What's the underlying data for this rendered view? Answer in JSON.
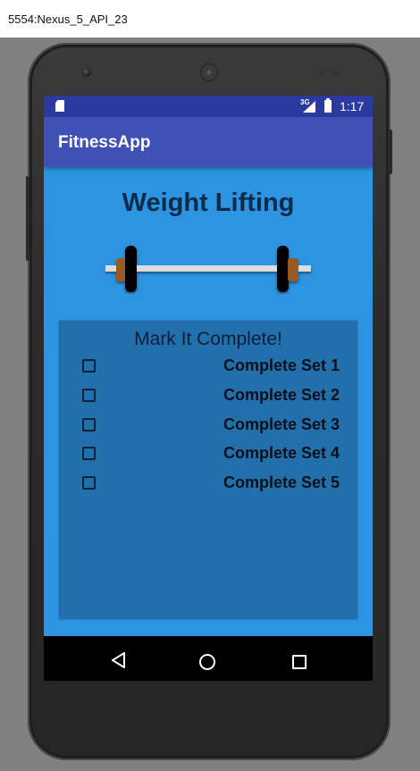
{
  "emulator": {
    "window_title": "5554:Nexus_5_API_23"
  },
  "status_bar": {
    "network_type": "3G",
    "time": "1:17",
    "icons": [
      "sd-card-icon",
      "signal-icon",
      "battery-icon"
    ]
  },
  "app_bar": {
    "title": "FitnessApp",
    "color": "#3f51b5"
  },
  "main": {
    "heading": "Weight Lifting",
    "image_icon": "barbell-icon",
    "background_color": "#2d94e2"
  },
  "checklist": {
    "title": "Mark It Complete!",
    "items": [
      {
        "label": "Complete Set 1",
        "checked": false
      },
      {
        "label": "Complete Set 2",
        "checked": false
      },
      {
        "label": "Complete Set 3",
        "checked": false
      },
      {
        "label": "Complete Set 4",
        "checked": false
      },
      {
        "label": "Complete Set 5",
        "checked": false
      }
    ]
  },
  "nav_bar": {
    "buttons": [
      "back-icon",
      "home-icon",
      "recents-icon"
    ]
  }
}
